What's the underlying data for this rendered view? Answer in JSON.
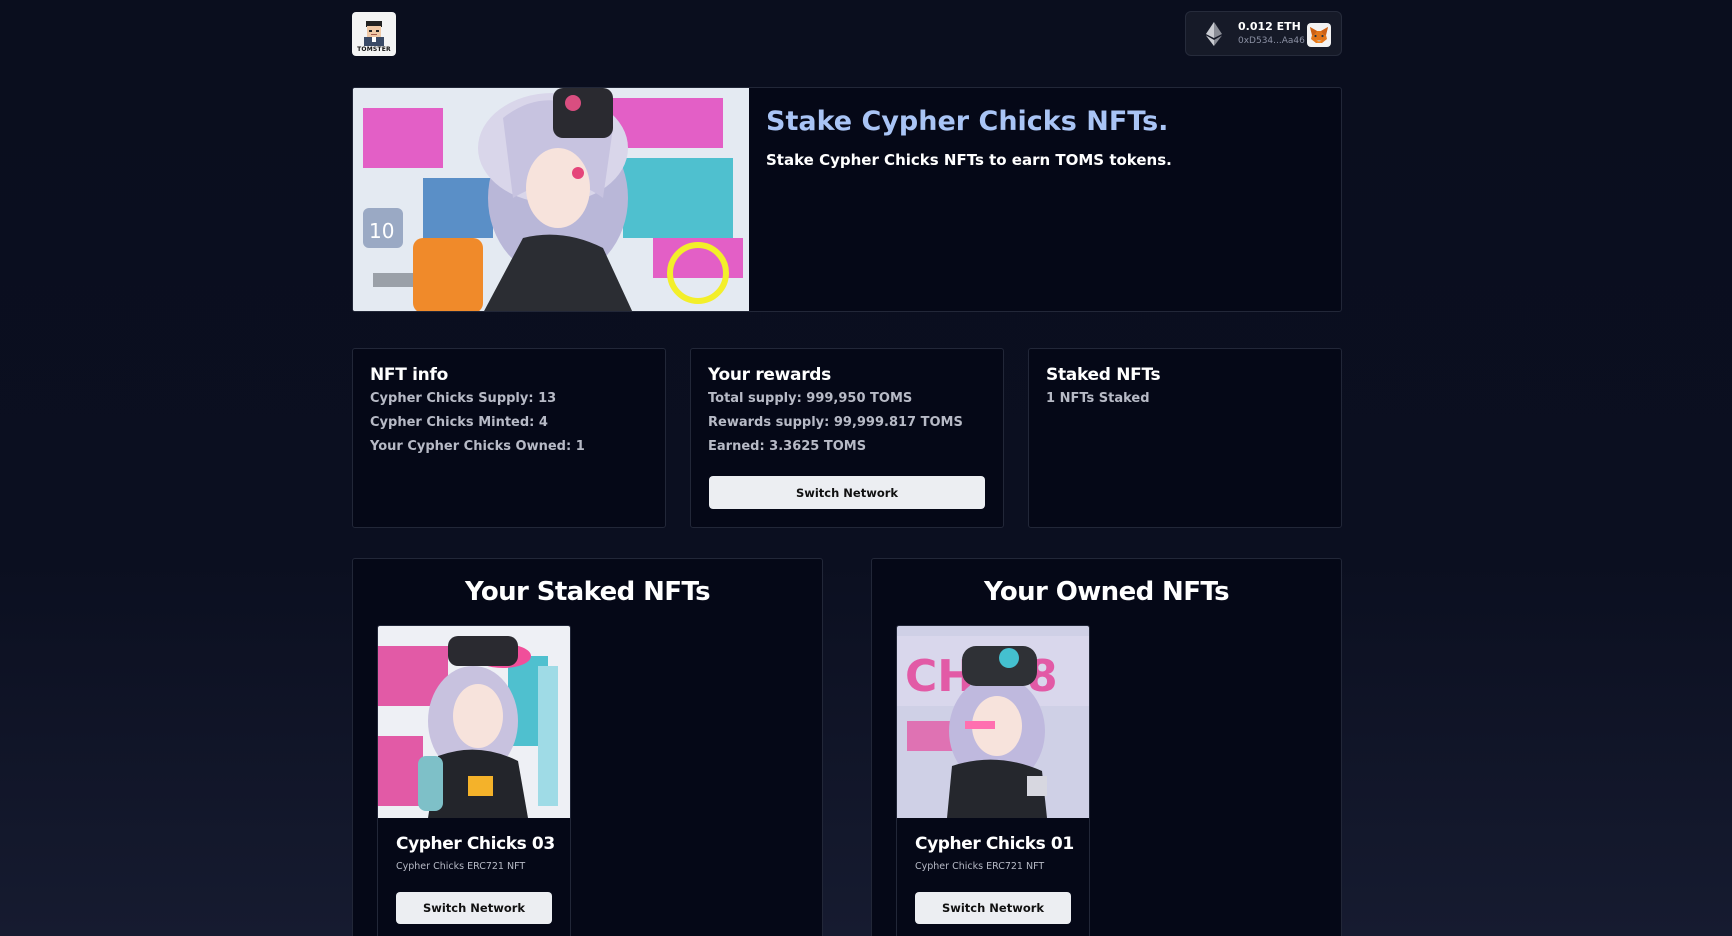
{
  "header": {
    "logo_text": "TOMSTER",
    "wallet": {
      "balance": "0.012 ETH",
      "address": "0xD534...Aa46"
    }
  },
  "hero": {
    "title": "Stake Cypher Chicks NFTs.",
    "subtitle": "Stake Cypher Chicks NFTs to earn TOMS tokens."
  },
  "nft_info": {
    "title": "NFT info",
    "lines": [
      "Cypher Chicks Supply: 13",
      "Cypher Chicks Minted: 4",
      "Your Cypher Chicks Owned: 1"
    ]
  },
  "rewards": {
    "title": "Your rewards",
    "lines": [
      "Total supply: 999,950 TOMS",
      "Rewards supply: 99,999.817 TOMS",
      "Earned: 3.3625 TOMS"
    ],
    "button": "Switch Network"
  },
  "staked_info": {
    "title": "Staked NFTs",
    "lines": [
      "1 NFTs Staked"
    ]
  },
  "staked_panel": {
    "title": "Your Staked NFTs",
    "items": [
      {
        "name": "Cypher Chicks 03",
        "description": "Cypher Chicks ERC721 NFT",
        "button": "Switch Network"
      }
    ]
  },
  "owned_panel": {
    "title": "Your Owned NFTs",
    "items": [
      {
        "name": "Cypher Chicks 01",
        "description": "Cypher Chicks ERC721 NFT",
        "button": "Switch Network"
      }
    ]
  },
  "colors": {
    "background": "#0a0e1e",
    "card": "#050817",
    "border": "#222738",
    "hero_title": "#a9c4f5",
    "button_bg": "#eceef2"
  }
}
